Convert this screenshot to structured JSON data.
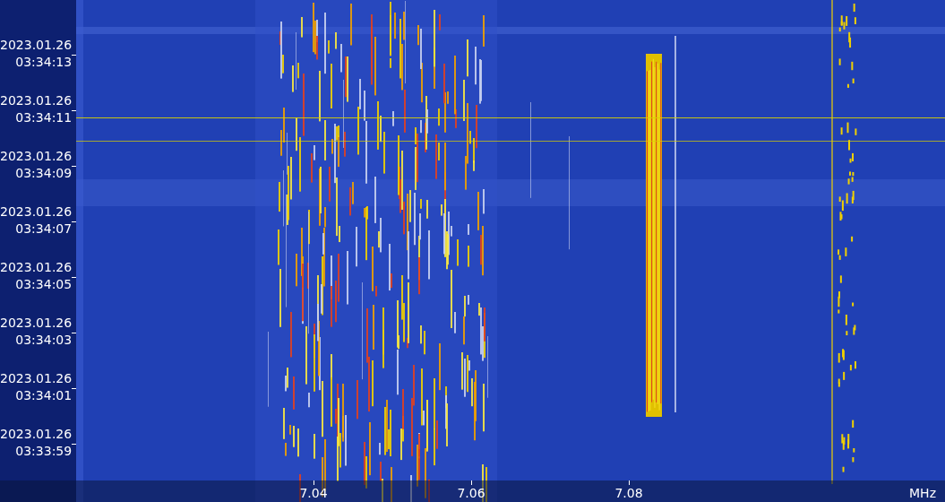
{
  "time_axis": {
    "labels": [
      {
        "date": "2023.01.26",
        "time": "03:34:13"
      },
      {
        "date": "2023.01.26",
        "time": "03:34:11"
      },
      {
        "date": "2023.01.26",
        "time": "03:34:09"
      },
      {
        "date": "2023.01.26",
        "time": "03:34:07"
      },
      {
        "date": "2023.01.26",
        "time": "03:34:05"
      },
      {
        "date": "2023.01.26",
        "time": "03:34:03"
      },
      {
        "date": "2023.01.26",
        "time": "03:34:01"
      },
      {
        "date": "2023.01.26",
        "time": "03:33:59"
      }
    ]
  },
  "frequency_axis": {
    "labels": [
      "7.04",
      "7.06",
      "7.08"
    ],
    "unit": "MHz"
  }
}
